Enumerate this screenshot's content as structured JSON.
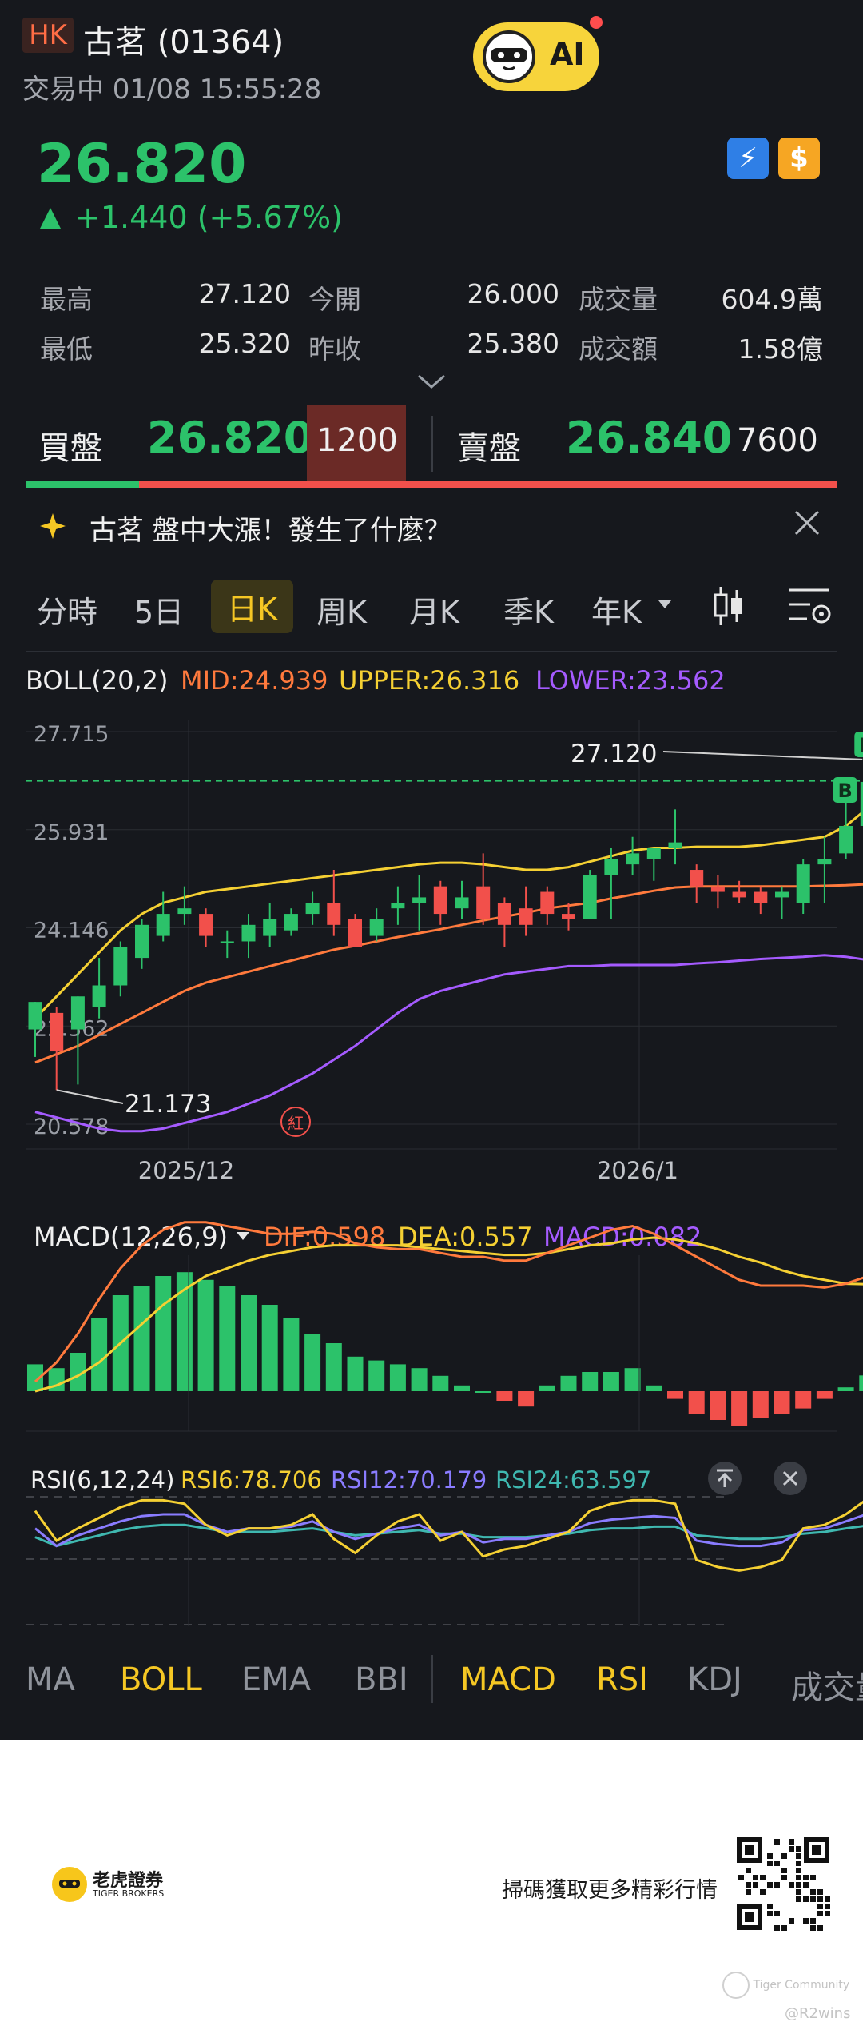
{
  "header": {
    "market": "HK",
    "title": "古茗 (01364)",
    "status": "交易中 01/08 15:55:28",
    "ai_label": "AI"
  },
  "quote": {
    "price": "26.820",
    "change": "+1.440 (+5.67%)",
    "stats": [
      {
        "label": "最高",
        "value": "27.120"
      },
      {
        "label": "今開",
        "value": "26.000"
      },
      {
        "label": "成交量",
        "value": "604.9萬"
      },
      {
        "label": "最低",
        "value": "25.320"
      },
      {
        "label": "昨收",
        "value": "25.380"
      },
      {
        "label": "成交額",
        "value": "1.58億"
      }
    ]
  },
  "orderbook": {
    "bid_label": "買盤",
    "bid_price": "26.820",
    "bid_qty": "1200",
    "ask_label": "賣盤",
    "ask_price": "26.840",
    "ask_qty": "7600",
    "bid_ratio": 0.14
  },
  "news": {
    "text": "古茗 盤中大漲！發生了什麼？"
  },
  "period_tabs": [
    "分時",
    "5日",
    "日K",
    "周K",
    "月K",
    "季K",
    "年K"
  ],
  "active_period": "日K",
  "boll": {
    "name": "BOLL(20,2)",
    "mid": "MID:24.939",
    "upper": "UPPER:26.316",
    "lower": "LOWER:23.562"
  },
  "macd": {
    "name": "MACD(12,26,9)",
    "dif": "DIF:0.598",
    "dea": "DEA:0.557",
    "macd": "MACD:0.082"
  },
  "rsi": {
    "name": "RSI(6,12,24)",
    "rsi6": "RSI6:78.706",
    "rsi12": "RSI12:70.179",
    "rsi24": "RSI24:63.597"
  },
  "chart_data": {
    "type": "candlestick",
    "y_ticks": [
      "27.715",
      "25.931",
      "24.146",
      "22.362",
      "20.578"
    ],
    "ylim": [
      20.578,
      27.715
    ],
    "x_labels": [
      "2025/12",
      "2026/1"
    ],
    "high_label": "27.120",
    "low_label": "21.173",
    "markers": [
      "B",
      "B",
      "紅"
    ],
    "candles": [
      {
        "o": 22.3,
        "h": 22.8,
        "l": 21.8,
        "c": 22.8
      },
      {
        "o": 22.6,
        "h": 22.7,
        "l": 21.2,
        "c": 21.9
      },
      {
        "o": 22.3,
        "h": 22.9,
        "l": 21.3,
        "c": 22.9
      },
      {
        "o": 22.7,
        "h": 23.6,
        "l": 22.5,
        "c": 23.1
      },
      {
        "o": 23.1,
        "h": 23.9,
        "l": 22.9,
        "c": 23.8
      },
      {
        "o": 23.6,
        "h": 24.3,
        "l": 23.4,
        "c": 24.2
      },
      {
        "o": 24.0,
        "h": 24.8,
        "l": 23.9,
        "c": 24.4
      },
      {
        "o": 24.4,
        "h": 24.9,
        "l": 24.2,
        "c": 24.5
      },
      {
        "o": 24.4,
        "h": 24.5,
        "l": 23.8,
        "c": 24.0
      },
      {
        "o": 23.9,
        "h": 24.1,
        "l": 23.6,
        "c": 23.9
      },
      {
        "o": 23.9,
        "h": 24.4,
        "l": 23.6,
        "c": 24.2
      },
      {
        "o": 24.0,
        "h": 24.6,
        "l": 23.8,
        "c": 24.3
      },
      {
        "o": 24.1,
        "h": 24.5,
        "l": 24.0,
        "c": 24.4
      },
      {
        "o": 24.4,
        "h": 24.8,
        "l": 24.2,
        "c": 24.6
      },
      {
        "o": 24.6,
        "h": 25.2,
        "l": 24.0,
        "c": 24.2
      },
      {
        "o": 24.3,
        "h": 24.4,
        "l": 23.8,
        "c": 23.8
      },
      {
        "o": 24.0,
        "h": 24.5,
        "l": 23.9,
        "c": 24.3
      },
      {
        "o": 24.5,
        "h": 24.9,
        "l": 24.2,
        "c": 24.6
      },
      {
        "o": 24.6,
        "h": 25.1,
        "l": 24.1,
        "c": 24.7
      },
      {
        "o": 24.9,
        "h": 25.0,
        "l": 24.2,
        "c": 24.4
      },
      {
        "o": 24.5,
        "h": 25.0,
        "l": 24.3,
        "c": 24.7
      },
      {
        "o": 24.9,
        "h": 25.5,
        "l": 24.2,
        "c": 24.3
      },
      {
        "o": 24.6,
        "h": 24.7,
        "l": 23.8,
        "c": 24.2
      },
      {
        "o": 24.5,
        "h": 24.9,
        "l": 24.0,
        "c": 24.2
      },
      {
        "o": 24.8,
        "h": 24.9,
        "l": 24.2,
        "c": 24.4
      },
      {
        "o": 24.4,
        "h": 24.6,
        "l": 24.1,
        "c": 24.3
      },
      {
        "o": 24.3,
        "h": 25.2,
        "l": 24.3,
        "c": 25.1
      },
      {
        "o": 25.1,
        "h": 25.6,
        "l": 24.3,
        "c": 25.4
      },
      {
        "o": 25.3,
        "h": 25.8,
        "l": 25.1,
        "c": 25.5
      },
      {
        "o": 25.4,
        "h": 25.6,
        "l": 25.0,
        "c": 25.6
      },
      {
        "o": 25.6,
        "h": 26.3,
        "l": 25.3,
        "c": 25.7
      },
      {
        "o": 25.2,
        "h": 25.3,
        "l": 24.6,
        "c": 24.9
      },
      {
        "o": 24.9,
        "h": 25.1,
        "l": 24.5,
        "c": 24.8
      },
      {
        "o": 24.8,
        "h": 25.0,
        "l": 24.6,
        "c": 24.7
      },
      {
        "o": 24.8,
        "h": 24.9,
        "l": 24.4,
        "c": 24.6
      },
      {
        "o": 24.7,
        "h": 24.9,
        "l": 24.3,
        "c": 24.8
      },
      {
        "o": 24.6,
        "h": 25.4,
        "l": 24.4,
        "c": 25.3
      },
      {
        "o": 25.3,
        "h": 25.8,
        "l": 24.6,
        "c": 25.4
      },
      {
        "o": 25.5,
        "h": 26.5,
        "l": 25.4,
        "c": 26.0
      },
      {
        "o": 26.0,
        "h": 27.1,
        "l": 25.3,
        "c": 26.8
      }
    ],
    "boll_mid": [
      21.7,
      21.85,
      22.0,
      22.2,
      22.4,
      22.6,
      22.8,
      23.0,
      23.15,
      23.25,
      23.35,
      23.45,
      23.55,
      23.65,
      23.75,
      23.82,
      23.9,
      23.98,
      24.05,
      24.12,
      24.2,
      24.28,
      24.35,
      24.42,
      24.5,
      24.55,
      24.6,
      24.68,
      24.75,
      24.82,
      24.88,
      24.9,
      24.9,
      24.9,
      24.9,
      24.9,
      24.9,
      24.91,
      24.92,
      24.939
    ],
    "boll_upper": [
      22.5,
      22.9,
      23.3,
      23.7,
      24.1,
      24.4,
      24.6,
      24.7,
      24.8,
      24.85,
      24.9,
      24.95,
      25.0,
      25.05,
      25.1,
      25.15,
      25.2,
      25.25,
      25.3,
      25.33,
      25.33,
      25.3,
      25.25,
      25.2,
      25.2,
      25.25,
      25.35,
      25.45,
      25.55,
      25.6,
      25.6,
      25.62,
      25.62,
      25.62,
      25.65,
      25.7,
      25.75,
      25.8,
      26.0,
      26.316
    ],
    "boll_lower": [
      20.8,
      20.7,
      20.6,
      20.5,
      20.45,
      20.45,
      20.5,
      20.6,
      20.7,
      20.8,
      20.95,
      21.1,
      21.3,
      21.5,
      21.75,
      22.0,
      22.3,
      22.6,
      22.85,
      23.0,
      23.1,
      23.2,
      23.3,
      23.35,
      23.4,
      23.45,
      23.45,
      23.47,
      23.47,
      23.47,
      23.47,
      23.5,
      23.52,
      23.55,
      23.58,
      23.6,
      23.62,
      23.65,
      23.62,
      23.562
    ],
    "macd_hist": [
      0.14,
      0.12,
      0.2,
      0.38,
      0.5,
      0.55,
      0.6,
      0.62,
      0.58,
      0.55,
      0.5,
      0.45,
      0.38,
      0.3,
      0.25,
      0.18,
      0.16,
      0.14,
      0.12,
      0.08,
      0.03,
      0.0,
      -0.05,
      -0.08,
      0.03,
      0.08,
      0.1,
      0.1,
      0.12,
      0.03,
      -0.04,
      -0.12,
      -0.15,
      -0.18,
      -0.14,
      -0.12,
      -0.09,
      -0.04,
      0.02,
      0.082
    ],
    "macd_dif": [
      0.05,
      0.15,
      0.3,
      0.48,
      0.64,
      0.76,
      0.84,
      0.88,
      0.88,
      0.86,
      0.84,
      0.82,
      0.82,
      0.83,
      0.82,
      0.77,
      0.75,
      0.74,
      0.74,
      0.72,
      0.7,
      0.7,
      0.68,
      0.68,
      0.72,
      0.76,
      0.8,
      0.84,
      0.86,
      0.82,
      0.76,
      0.7,
      0.64,
      0.58,
      0.55,
      0.55,
      0.55,
      0.54,
      0.56,
      0.598
    ],
    "macd_dea": [
      0.0,
      0.03,
      0.08,
      0.15,
      0.25,
      0.35,
      0.45,
      0.53,
      0.6,
      0.64,
      0.68,
      0.71,
      0.73,
      0.75,
      0.76,
      0.76,
      0.76,
      0.76,
      0.75,
      0.74,
      0.73,
      0.72,
      0.71,
      0.71,
      0.72,
      0.74,
      0.76,
      0.77,
      0.79,
      0.8,
      0.79,
      0.77,
      0.74,
      0.7,
      0.67,
      0.63,
      0.6,
      0.58,
      0.56,
      0.557
    ],
    "rsi6": [
      72,
      55,
      62,
      68,
      74,
      78,
      78,
      76,
      64,
      58,
      62,
      62,
      64,
      70,
      56,
      48,
      58,
      66,
      70,
      55,
      60,
      46,
      50,
      52,
      56,
      60,
      72,
      76,
      78,
      78,
      76,
      44,
      40,
      38,
      40,
      44,
      62,
      64,
      70,
      78.706
    ],
    "rsi12": [
      62,
      52,
      58,
      62,
      66,
      69,
      70,
      70,
      64,
      60,
      62,
      62,
      63,
      66,
      60,
      56,
      59,
      62,
      64,
      58,
      60,
      54,
      56,
      56,
      58,
      60,
      65,
      67,
      68,
      69,
      68,
      55,
      53,
      52,
      52,
      54,
      61,
      62,
      66,
      70.179
    ],
    "rsi24": [
      57,
      52,
      55,
      58,
      61,
      63,
      64,
      64,
      62,
      60,
      60,
      60,
      61,
      62,
      60,
      58,
      59,
      60,
      61,
      59,
      59,
      57,
      57,
      57,
      58,
      59,
      61,
      62,
      62,
      63,
      63,
      58,
      57,
      56,
      56,
      57,
      59,
      60,
      62,
      63.597
    ]
  },
  "indicator_tabs": [
    {
      "label": "MA",
      "active": false
    },
    {
      "label": "BOLL",
      "active": true
    },
    {
      "label": "EMA",
      "active": false
    },
    {
      "label": "BBI",
      "active": false
    },
    {
      "label": "MACD",
      "active": true
    },
    {
      "label": "RSI",
      "active": true
    },
    {
      "label": "KDJ",
      "active": false
    },
    {
      "label": "成交量",
      "active": false
    }
  ],
  "footer": {
    "brand": "老虎證券",
    "brand_en": "TIGER BROKERS",
    "scan_text": "掃碼獲取更多精彩行情",
    "community": "Tiger Community",
    "user": "@R2wins"
  },
  "colors": {
    "up": "#2cc26a",
    "down": "#f2504b",
    "accent": "#f5c724",
    "mid": "#ff7a3d",
    "upper": "#f5d033",
    "lower": "#a55bff",
    "rsi24": "#3fb8b0"
  }
}
